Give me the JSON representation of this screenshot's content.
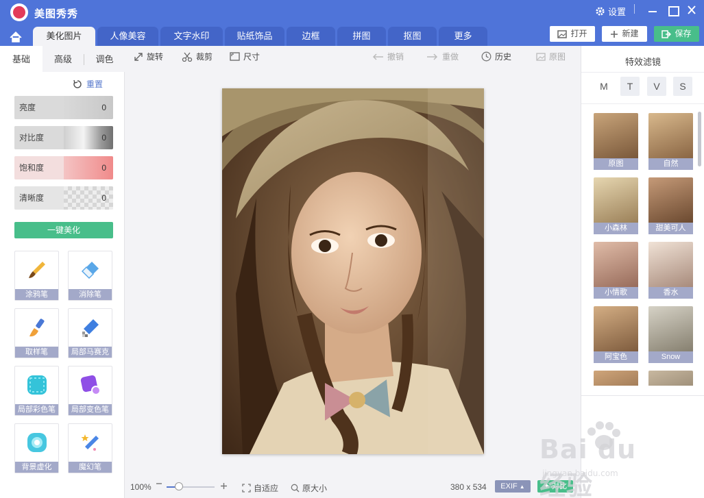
{
  "app": {
    "title": "美图秀秀",
    "settings_label": "设置"
  },
  "main_tabs": [
    "美化图片",
    "人像美容",
    "文字水印",
    "贴纸饰品",
    "边框",
    "拼图",
    "抠图",
    "更多"
  ],
  "actions": {
    "open": "打开",
    "new": "新建",
    "save": "保存"
  },
  "left_panel": {
    "tabs": [
      "基础",
      "高级",
      "调色"
    ],
    "reset": "重置",
    "sliders": [
      {
        "label": "亮度",
        "value": "0"
      },
      {
        "label": "对比度",
        "value": "0"
      },
      {
        "label": "饱和度",
        "value": "0"
      },
      {
        "label": "清晰度",
        "value": "0"
      }
    ],
    "auto_beautify": "一键美化",
    "tools": [
      "涂鸦笔",
      "消除笔",
      "取样笔",
      "局部马赛克",
      "局部彩色笔",
      "局部变色笔",
      "背景虚化",
      "魔幻笔"
    ]
  },
  "toolbar": {
    "rotate": "旋转",
    "crop": "裁剪",
    "resize": "尺寸",
    "undo": "撤销",
    "redo": "重做",
    "history": "历史",
    "original": "原图"
  },
  "status": {
    "zoom": "100%",
    "fit": "自适应",
    "actual_size": "原大小",
    "dimensions": "380 x 534",
    "exif": "EXIF",
    "compare": "对比"
  },
  "right_panel": {
    "title": "特效滤镜",
    "categories": [
      "M",
      "T",
      "V",
      "S"
    ],
    "filters": [
      "原图",
      "自然",
      "小森林",
      "甜美可人",
      "小情歌",
      "香水",
      "阿宝色",
      "Snow"
    ]
  },
  "watermark": {
    "main": "Bai du 经验",
    "sub": "jingyan.baidu.com"
  },
  "colors": {
    "brand_blue": "#4f74d9",
    "accent_green": "#48be8a",
    "label_gray": "#a3a9c9"
  }
}
